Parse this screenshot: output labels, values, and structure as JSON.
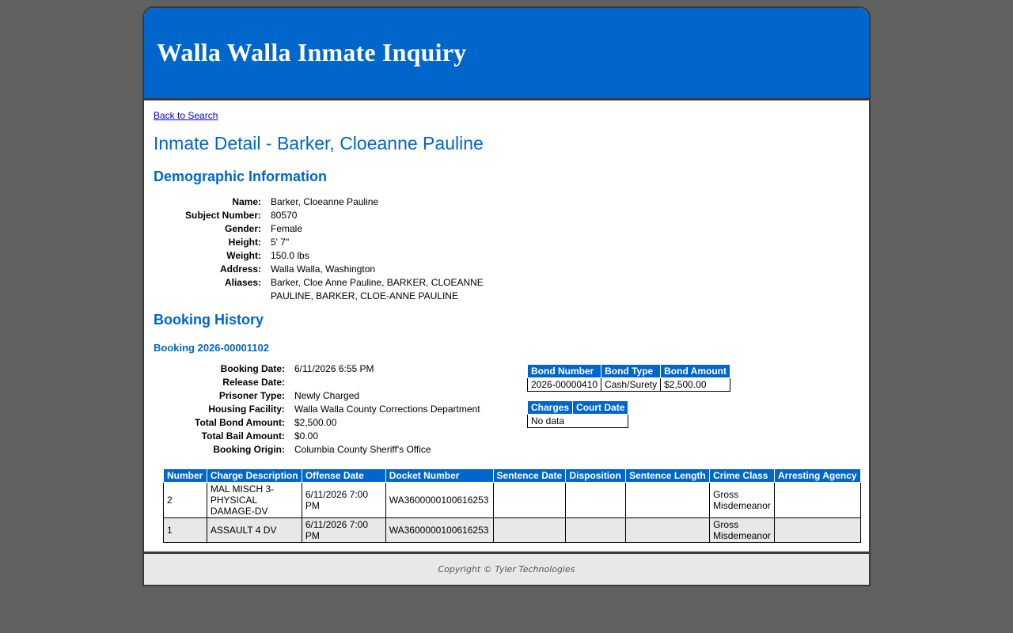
{
  "header": {
    "title": "Walla Walla Inmate Inquiry"
  },
  "nav": {
    "back_label": "Back to Search"
  },
  "page_title": "Inmate Detail - Barker, Cloeanne Pauline",
  "demographic": {
    "title": "Demographic Information",
    "fields": [
      {
        "label": "Name:",
        "value": "Barker, Cloeanne Pauline"
      },
      {
        "label": "Subject Number:",
        "value": "80570"
      },
      {
        "label": "Gender:",
        "value": "Female"
      },
      {
        "label": "Height:",
        "value": "5' 7\""
      },
      {
        "label": "Weight:",
        "value": "150.0 lbs"
      },
      {
        "label": "Address:",
        "value": "Walla Walla, Washington"
      },
      {
        "label": "Aliases:",
        "value": "Barker, Cloe Anne Pauline, BARKER, CLOEANNE PAULINE, BARKER, CLOE-ANNE PAULINE"
      }
    ]
  },
  "booking_history": {
    "title": "Booking History",
    "booking": {
      "title": "Booking 2026-00001102",
      "fields": [
        {
          "label": "Booking Date:",
          "value": "6/11/2026 6:55 PM"
        },
        {
          "label": "Release Date:",
          "value": ""
        },
        {
          "label": "Prisoner Type:",
          "value": "Newly Charged"
        },
        {
          "label": "Housing Facility:",
          "value": "Walla Walla County Corrections Department"
        },
        {
          "label": "Total Bond Amount:",
          "value": "$2,500.00"
        },
        {
          "label": "Total Bail Amount:",
          "value": "$0.00"
        },
        {
          "label": "Booking Origin:",
          "value": "Columbia County Sheriff's Office"
        }
      ],
      "bond_table": {
        "headers": [
          "Bond Number",
          "Bond Type",
          "Bond Amount"
        ],
        "rows": [
          [
            "2026-00000410",
            "Cash/Surety",
            "$2,500.00"
          ]
        ]
      },
      "court_table": {
        "headers": [
          "Charges",
          "Court Date"
        ],
        "empty": "No data"
      },
      "charges_table": {
        "headers": [
          "Number",
          "Charge Description",
          "Offense Date",
          "Docket Number",
          "Sentence Date",
          "Disposition",
          "Sentence Length",
          "Crime Class",
          "Arresting Agency"
        ],
        "rows": [
          [
            "2",
            "MAL MISCH 3-PHYSICAL DAMAGE-DV",
            "6/11/2026 7:00 PM",
            "WA3600000100616253",
            "",
            "",
            "",
            "Gross Misdemeanor",
            ""
          ],
          [
            "1",
            "ASSAULT 4 DV",
            "6/11/2026 7:00 PM",
            "WA3600000100616253",
            "",
            "",
            "",
            "Gross Misdemeanor",
            ""
          ]
        ]
      }
    }
  },
  "footer": {
    "copyright": "Copyright © Tyler Technologies"
  },
  "colors": {
    "brand": "#0066cc",
    "page_bg": "#606060",
    "footer_bg": "#e8e8e8"
  }
}
